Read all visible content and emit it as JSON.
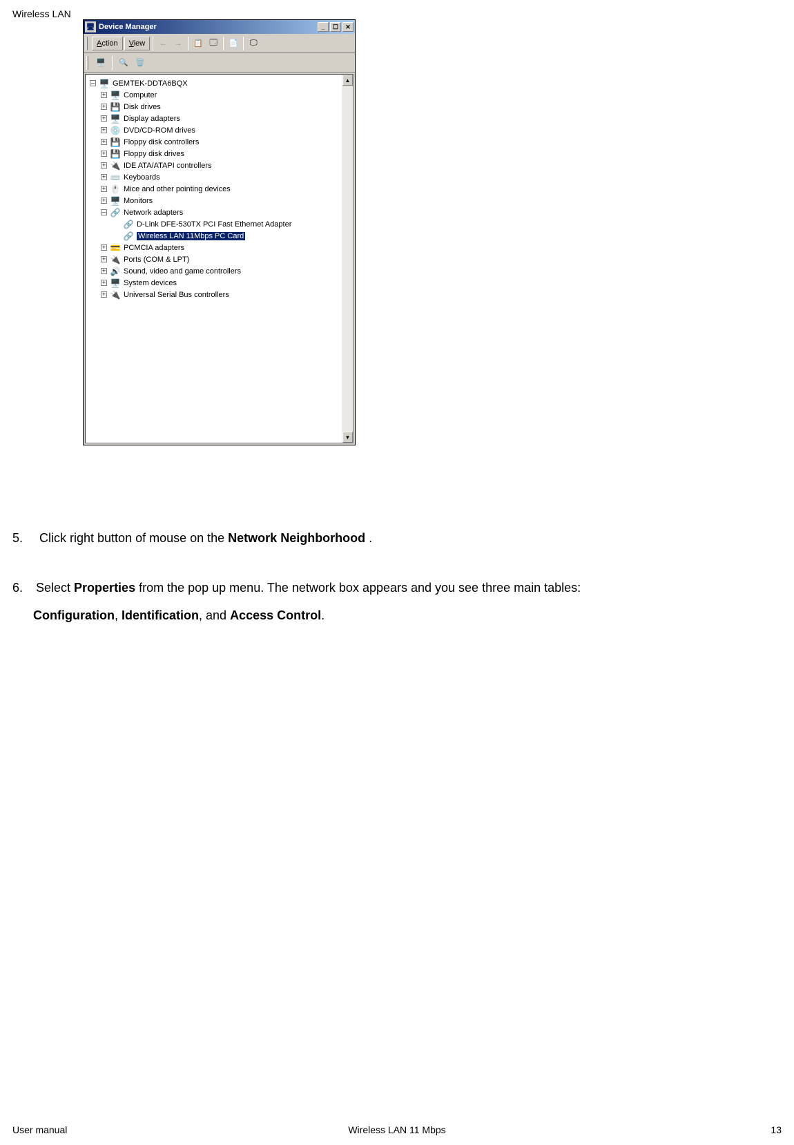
{
  "header": {
    "text": "Wireless LAN"
  },
  "window": {
    "title": "Device Manager",
    "menu": {
      "action_u": "A",
      "action_rest": "ction",
      "view_u": "V",
      "view_rest": "iew"
    },
    "tree": {
      "root": "GEMTEK-DDTA6BQX",
      "items": [
        "Computer",
        "Disk drives",
        "Display adapters",
        "DVD/CD-ROM drives",
        "Floppy disk controllers",
        "Floppy disk drives",
        "IDE ATA/ATAPI controllers",
        "Keyboards",
        "Mice and other pointing devices",
        "Monitors",
        "Network adapters",
        "PCMCIA adapters",
        "Ports (COM & LPT)",
        "Sound, video and game controllers",
        "System devices",
        "Universal Serial Bus controllers"
      ],
      "network_children": [
        "D-Link DFE-530TX PCI Fast Ethernet Adapter",
        "Wireless LAN 11Mbps PC Card"
      ]
    }
  },
  "body": {
    "step5_num": "5.",
    "step5_a": "Click right button of mouse on the ",
    "step5_b": "Network Neighborhood",
    "step5_c": " .",
    "step6_num": "6.",
    "step6_a": "Select ",
    "step6_b": "Properties",
    "step6_c": " from the pop up menu. The network box appears and you see three main tables:",
    "step6_d": "Configuration",
    "step6_e": ", ",
    "step6_f": "Identification",
    "step6_g": ", and ",
    "step6_h": "Access Control",
    "step6_i": "."
  },
  "footer": {
    "left": "User manual",
    "center": "Wireless LAN 11 Mbps",
    "right": "13"
  }
}
